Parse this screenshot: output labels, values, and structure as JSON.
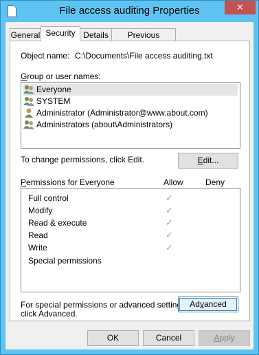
{
  "window": {
    "title": "File access auditing Properties",
    "close_label": "✕"
  },
  "tabs": [
    "General",
    "Security",
    "Details",
    "Previous Versions"
  ],
  "object_name_label": "Object name:",
  "object_name_value": "C:\\Documents\\File access auditing.txt",
  "group_label": "Group or user names:",
  "users": [
    {
      "name": "Everyone",
      "icon": "group-icon"
    },
    {
      "name": "SYSTEM",
      "icon": "group-icon"
    },
    {
      "name": "Administrator (Administrator@www.about.com)",
      "icon": "user-icon"
    },
    {
      "name": "Administrators (about\\Administrators)",
      "icon": "group-icon"
    }
  ],
  "change_text": "To change permissions, click Edit.",
  "edit_button": "Edit...",
  "permissions_header": "Permissions for Everyone",
  "allow_header": "Allow",
  "deny_header": "Deny",
  "permissions": [
    {
      "name": "Full control",
      "allow": true,
      "deny": false
    },
    {
      "name": "Modify",
      "allow": true,
      "deny": false
    },
    {
      "name": "Read & execute",
      "allow": true,
      "deny": false
    },
    {
      "name": "Read",
      "allow": true,
      "deny": false
    },
    {
      "name": "Write",
      "allow": true,
      "deny": false
    },
    {
      "name": "Special permissions",
      "allow": false,
      "deny": false
    }
  ],
  "advanced_text_1": "For special permissions or advanced settings,",
  "advanced_text_2": "click Advanced.",
  "advanced_button": "Advanced",
  "ok_button": "OK",
  "cancel_button": "Cancel",
  "apply_button": "Apply",
  "checkmark": "✓"
}
